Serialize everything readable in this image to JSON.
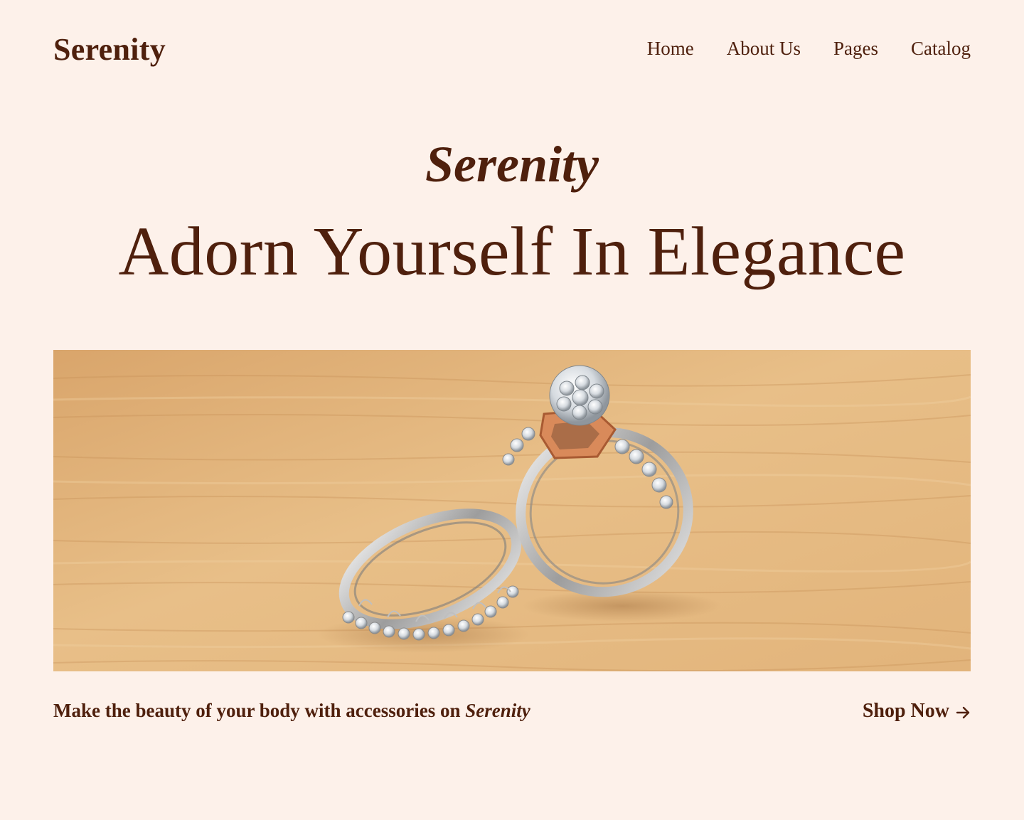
{
  "header": {
    "logo": "Serenity",
    "menu": [
      {
        "label": "Home"
      },
      {
        "label": "About Us"
      },
      {
        "label": "Pages"
      },
      {
        "label": "Catalog"
      }
    ]
  },
  "hero": {
    "subtitle": "Serenity",
    "title": "Adorn Yourself In Elegance",
    "image": {
      "subject": "two diamond rings on a wooden surface"
    }
  },
  "footer_bar": {
    "tagline_prefix": "Make the beauty of your body with accessories on ",
    "tagline_brand": "Serenity",
    "cta_label": "Shop Now",
    "cta_icon": "arrow-right-icon"
  },
  "colors": {
    "background": "#fdf1ea",
    "text": "#4f200d",
    "wood": "#e3b67f"
  }
}
